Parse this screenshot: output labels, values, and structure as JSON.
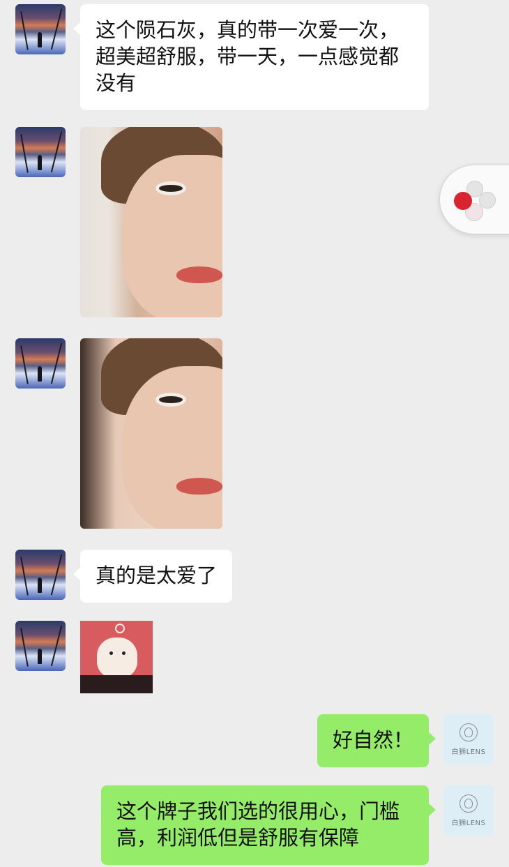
{
  "messages": [
    {
      "type": "text",
      "side": "left",
      "text": "这个陨石灰，真的带一次爱一次，超美超舒服，带一天，一点感觉都没有"
    },
    {
      "type": "image",
      "side": "left"
    },
    {
      "type": "image",
      "side": "left"
    },
    {
      "type": "text",
      "side": "left",
      "text": "真的是太爱了"
    },
    {
      "type": "sticker",
      "side": "left"
    },
    {
      "type": "text",
      "side": "right",
      "text": "好自然！"
    },
    {
      "type": "text",
      "side": "right",
      "text": "这个牌子我们选的很用心，门槛高，利润低但是舒服有保障"
    }
  ],
  "right_avatar": {
    "brand": "白狮LENS"
  },
  "icons": {
    "float_widget": "floating-assistant-icon"
  }
}
